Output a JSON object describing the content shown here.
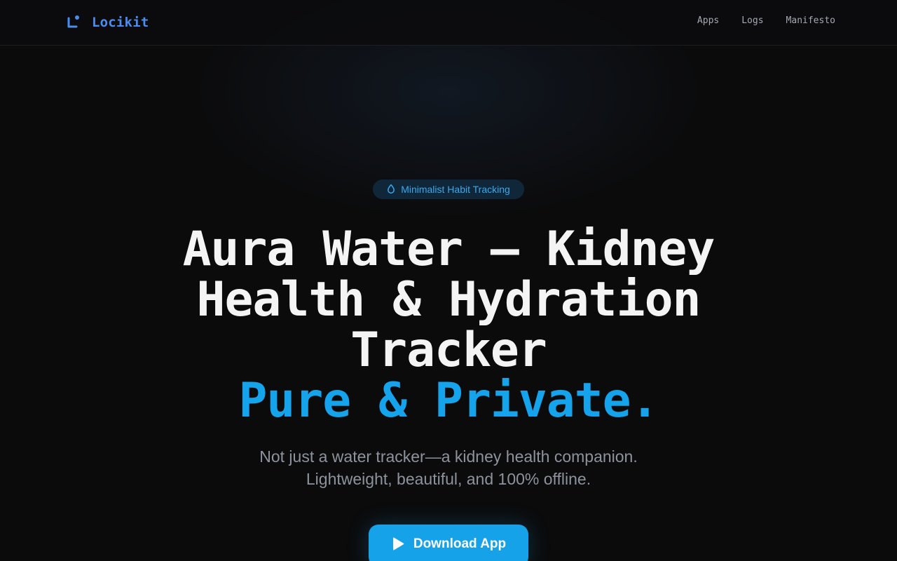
{
  "brand": {
    "name": "Locikit",
    "color": "#4a8df0",
    "icon": "locikit-logo-icon"
  },
  "nav": {
    "items": [
      "Apps",
      "Logs",
      "Manifesto"
    ]
  },
  "hero": {
    "badge": {
      "icon": "water-drop-icon",
      "label": "Minimalist Habit Tracking"
    },
    "title": "Aura Water — Kidney Health & Hydration Tracker",
    "title_accent": "Pure & Private.",
    "subtitle_line1": "Not just a water tracker—a kidney health companion.",
    "subtitle_line2": "Lightweight, beautiful, and 100% offline.",
    "cta": {
      "label": "Download App",
      "icon": "play-store-icon"
    }
  },
  "colors": {
    "background": "#0b0b0c",
    "accent": "#15a4ec",
    "text": "#f4f4f5",
    "muted": "#8d939d"
  }
}
